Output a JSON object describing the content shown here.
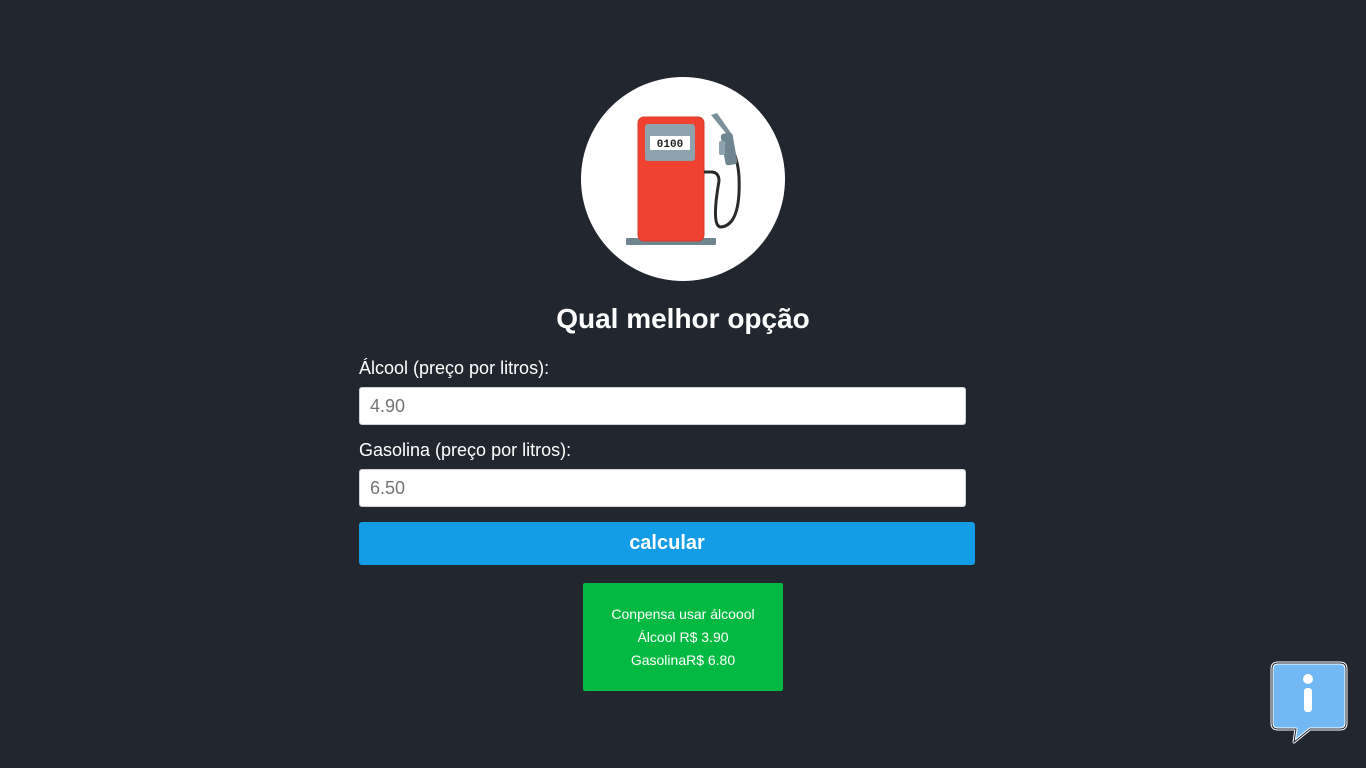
{
  "logo": {
    "icon": "fuel-pump-icon",
    "pump_display": "0100"
  },
  "title": "Qual melhor opção",
  "form": {
    "alcool_label": "Álcool (preço por litros):",
    "alcool_placeholder": "4.90",
    "gasolina_label": "Gasolina (preço por litros):",
    "gasolina_placeholder": "6.50",
    "button_label": "calcular"
  },
  "result": {
    "message": "Conpensa usar álcoool",
    "alcool_line": "Álcool R$ 3.90",
    "gasolina_line": "GasolinaR$ 6.80"
  },
  "info_widget": {
    "icon": "info-icon"
  },
  "colors": {
    "background": "#22262e",
    "button": "#129de6",
    "result_box": "#02b942",
    "pump_body": "#ef4230",
    "info_bubble": "#71b8f5"
  }
}
